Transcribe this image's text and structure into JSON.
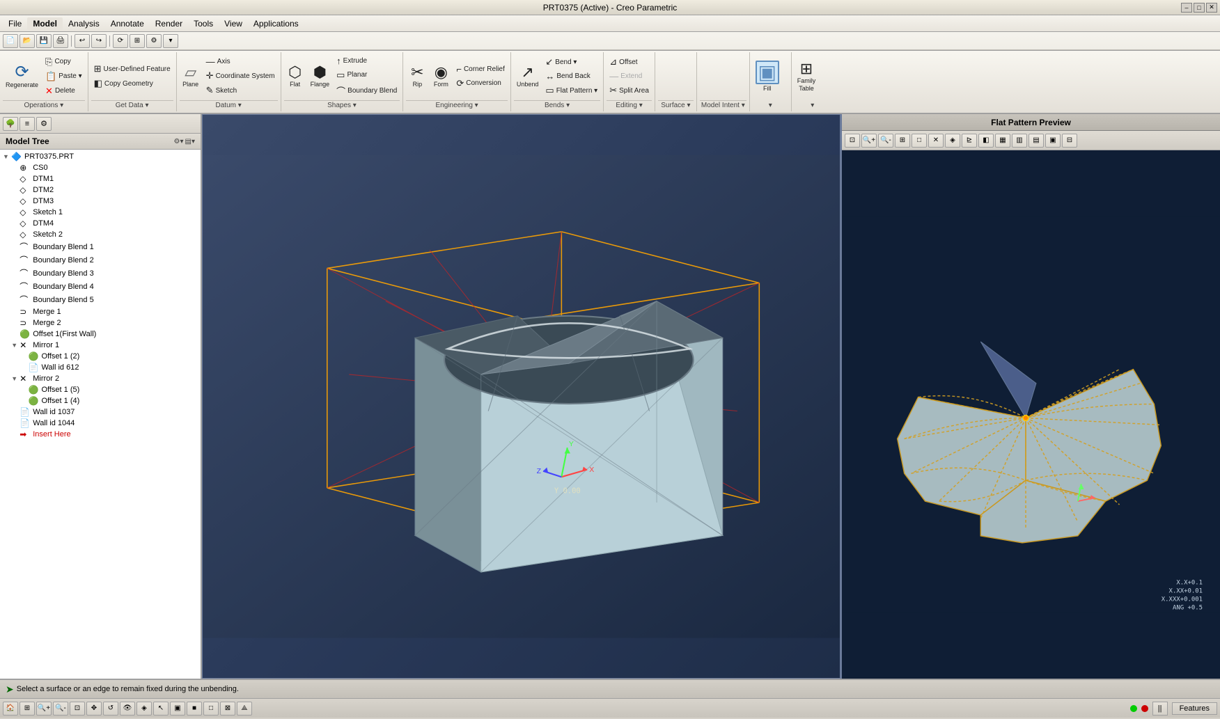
{
  "titlebar": {
    "title": "PRT0375 (Active) - Creo Parametric",
    "min": "–",
    "max": "□",
    "close": "✕"
  },
  "menubar": {
    "items": [
      {
        "id": "file",
        "label": "File",
        "active": false
      },
      {
        "id": "model",
        "label": "Model",
        "active": true
      },
      {
        "id": "analysis",
        "label": "Analysis",
        "active": false
      },
      {
        "id": "annotate",
        "label": "Annotate",
        "active": false
      },
      {
        "id": "render",
        "label": "Render",
        "active": false
      },
      {
        "id": "tools",
        "label": "Tools",
        "active": false
      },
      {
        "id": "view",
        "label": "View",
        "active": false
      },
      {
        "id": "applications",
        "label": "Applications",
        "active": false
      }
    ]
  },
  "ribbon": {
    "groups": [
      {
        "id": "operations",
        "label": "Operations",
        "buttons": [
          {
            "icon": "⟳",
            "label": "Regenerate",
            "size": "large"
          },
          {
            "icon": "⎘",
            "label": "Copy",
            "size": "small"
          },
          {
            "icon": "📋",
            "label": "Paste",
            "size": "small"
          },
          {
            "icon": "✕",
            "label": "Delete",
            "size": "small"
          }
        ]
      },
      {
        "id": "get-data",
        "label": "Get Data",
        "buttons": [
          {
            "icon": "⊞",
            "label": "User-Defined Feature",
            "size": "small"
          },
          {
            "icon": "◫",
            "label": "Copy Geometry",
            "size": "small"
          }
        ]
      },
      {
        "id": "datum",
        "label": "Datum",
        "buttons": [
          {
            "icon": "▱",
            "label": "Plane",
            "size": "large"
          },
          {
            "icon": "—",
            "label": "Axis",
            "size": "small"
          },
          {
            "icon": "✛",
            "label": "Coordinate System",
            "size": "small"
          },
          {
            "icon": "✎",
            "label": "Sketch",
            "size": "small"
          }
        ]
      },
      {
        "id": "shapes",
        "label": "Shapes",
        "buttons": [
          {
            "icon": "⬡",
            "label": "Flat",
            "size": "large"
          },
          {
            "icon": "⬢",
            "label": "Flange",
            "size": "large"
          },
          {
            "icon": "↑",
            "label": "Extrude",
            "size": "small"
          },
          {
            "icon": "▭",
            "label": "Planar",
            "size": "small"
          },
          {
            "icon": "⌒",
            "label": "Boundary Blend",
            "size": "small"
          }
        ]
      },
      {
        "id": "engineering",
        "label": "Engineering",
        "buttons": [
          {
            "icon": "✂",
            "label": "Rip",
            "size": "large"
          },
          {
            "icon": "◉",
            "label": "Form",
            "size": "large"
          },
          {
            "icon": "⌐",
            "label": "Corner Relief",
            "size": "small"
          },
          {
            "icon": "⟳",
            "label": "Conversion",
            "size": "small"
          }
        ]
      },
      {
        "id": "bends",
        "label": "Bends",
        "buttons": [
          {
            "icon": "↗",
            "label": "Unbend",
            "size": "large"
          },
          {
            "icon": "↙",
            "label": "Bend",
            "size": "small"
          },
          {
            "icon": "↔",
            "label": "Bend Back",
            "size": "small"
          },
          {
            "icon": "▭",
            "label": "Flat Pattern",
            "size": "small"
          }
        ]
      },
      {
        "id": "editing",
        "label": "Editing",
        "buttons": [
          {
            "icon": "⊿",
            "label": "Offset",
            "size": "small"
          },
          {
            "icon": "—",
            "label": "Extend",
            "size": "small"
          },
          {
            "icon": "✂",
            "label": "Split Area",
            "size": "small"
          }
        ]
      },
      {
        "id": "surface",
        "label": "Surface",
        "buttons": []
      },
      {
        "id": "model-intent",
        "label": "Model Intent",
        "buttons": []
      },
      {
        "id": "fill",
        "label": "Fill",
        "buttons": [
          {
            "icon": "▣",
            "label": "Fill",
            "size": "large"
          }
        ]
      },
      {
        "id": "family-table",
        "label": "Family Table",
        "buttons": [
          {
            "icon": "⊞",
            "label": "Family\nTable",
            "size": "large"
          }
        ]
      }
    ]
  },
  "left_panel": {
    "title": "Model Tree",
    "tree_items": [
      {
        "id": "root",
        "label": "PRT0375.PRT",
        "icon": "🔷",
        "indent": 0,
        "expand": "▼"
      },
      {
        "id": "cs0",
        "label": "CS0",
        "icon": "⊕",
        "indent": 1,
        "expand": ""
      },
      {
        "id": "dtm1",
        "label": "DTM1",
        "icon": "◇",
        "indent": 1,
        "expand": ""
      },
      {
        "id": "dtm2",
        "label": "DTM2",
        "icon": "◇",
        "indent": 1,
        "expand": ""
      },
      {
        "id": "dtm3",
        "label": "DTM3",
        "icon": "◇",
        "indent": 1,
        "expand": ""
      },
      {
        "id": "sketch1",
        "label": "Sketch 1",
        "icon": "◇",
        "indent": 1,
        "expand": ""
      },
      {
        "id": "dtm4",
        "label": "DTM4",
        "icon": "◇",
        "indent": 1,
        "expand": ""
      },
      {
        "id": "sketch2",
        "label": "Sketch 2",
        "icon": "◇",
        "indent": 1,
        "expand": ""
      },
      {
        "id": "bb1",
        "label": "Boundary Blend 1",
        "icon": "⌒",
        "indent": 1,
        "expand": ""
      },
      {
        "id": "bb2",
        "label": "Boundary Blend 2",
        "icon": "⌒",
        "indent": 1,
        "expand": ""
      },
      {
        "id": "bb3",
        "label": "Boundary Blend 3",
        "icon": "⌒",
        "indent": 1,
        "expand": ""
      },
      {
        "id": "bb4",
        "label": "Boundary Blend 4",
        "icon": "⌒",
        "indent": 1,
        "expand": ""
      },
      {
        "id": "bb5",
        "label": "Boundary Blend 5",
        "icon": "⌒",
        "indent": 1,
        "expand": ""
      },
      {
        "id": "merge1",
        "label": "Merge 1",
        "icon": "⊃",
        "indent": 1,
        "expand": ""
      },
      {
        "id": "merge2",
        "label": "Merge 2",
        "icon": "⊃",
        "indent": 1,
        "expand": ""
      },
      {
        "id": "offset1fw",
        "label": "Offset 1(First Wall)",
        "icon": "🟢",
        "indent": 1,
        "expand": ""
      },
      {
        "id": "mirror1",
        "label": "Mirror 1",
        "icon": "✕",
        "indent": 1,
        "expand": "▼"
      },
      {
        "id": "offset12",
        "label": "Offset 1 (2)",
        "icon": "🟢",
        "indent": 2,
        "expand": ""
      },
      {
        "id": "wallid612",
        "label": "Wall id 612",
        "icon": "📄",
        "indent": 2,
        "expand": ""
      },
      {
        "id": "mirror2",
        "label": "Mirror 2",
        "icon": "✕",
        "indent": 1,
        "expand": "▼"
      },
      {
        "id": "offset15",
        "label": "Offset 1 (5)",
        "icon": "🟢",
        "indent": 2,
        "expand": ""
      },
      {
        "id": "offset14",
        "label": "Offset 1 (4)",
        "icon": "🟢",
        "indent": 2,
        "expand": ""
      },
      {
        "id": "wallid1037",
        "label": "Wall id 1037",
        "icon": "📄",
        "indent": 1,
        "expand": ""
      },
      {
        "id": "wallid1044",
        "label": "Wall id 1044",
        "icon": "📄",
        "indent": 1,
        "expand": ""
      },
      {
        "id": "insert",
        "label": "Insert Here",
        "icon": "➡",
        "indent": 1,
        "expand": ""
      }
    ]
  },
  "flat_pattern_preview": {
    "title": "Flat Pattern Preview"
  },
  "status_bar": {
    "message": "Select a surface or an edge to remain fixed during the unbending.",
    "icon": "➤"
  },
  "bottom_toolbar": {
    "features_label": "Features"
  },
  "coord_display": {
    "x": "X.X+0.1",
    "xx": "X.XX+0.01",
    "xxx": "X.XXX+0.001",
    "ang": "ANG +0.5"
  }
}
